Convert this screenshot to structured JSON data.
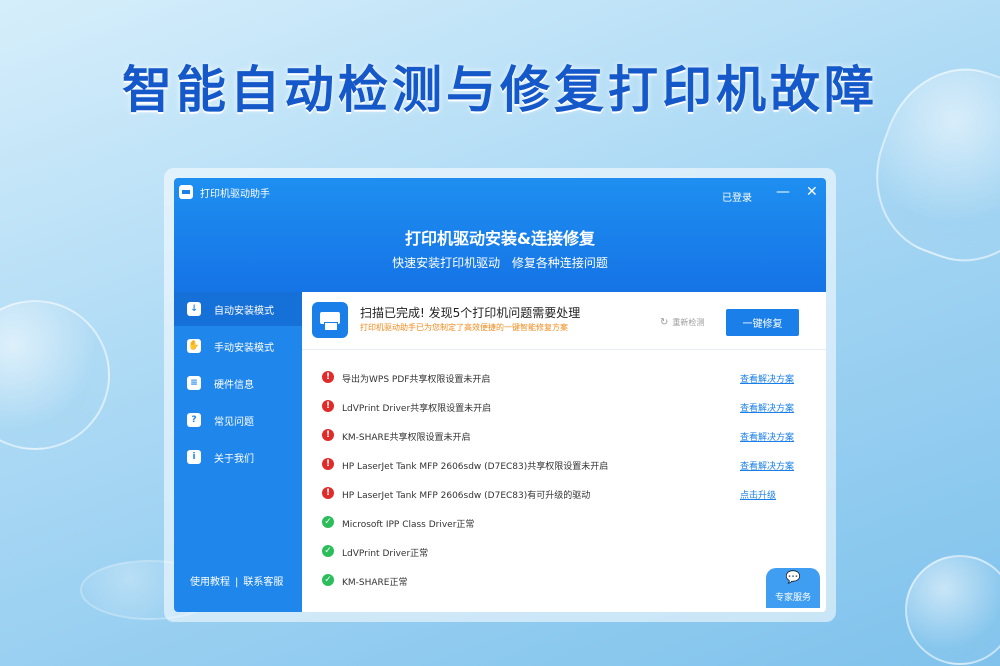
{
  "headline": "智能自动检测与修复打印机故障",
  "window": {
    "app_title": "打印机驱动助手",
    "login_label": "已登录",
    "minimize_glyph": "—",
    "close_glyph": "✕",
    "hero_title": "打印机驱动安装&连接修复",
    "hero_subtitle": "快速安装打印机驱动 修复各种连接问题"
  },
  "sidebar": {
    "items": [
      {
        "label": "自动安装模式",
        "icon": "download-icon",
        "glyph": "↓",
        "active": true
      },
      {
        "label": "手动安装模式",
        "icon": "hand-icon",
        "glyph": "✋",
        "active": false
      },
      {
        "label": "硬件信息",
        "icon": "list-icon",
        "glyph": "≡",
        "active": false
      },
      {
        "label": "常见问题",
        "icon": "question-icon",
        "glyph": "?",
        "active": false
      },
      {
        "label": "关于我们",
        "icon": "info-icon",
        "glyph": "i",
        "active": false
      }
    ],
    "footer_tutorial": "使用教程",
    "footer_separator": "|",
    "footer_contact": "联系客服"
  },
  "banner": {
    "title": "扫描已完成! 发现5个打印机问题需要处理",
    "subtitle": "打印机驱动助手已为您制定了高效便捷的一键智能修复方案",
    "recheck_label": "重新检测",
    "recheck_glyph": "↻",
    "fix_button": "一键修复"
  },
  "issues": [
    {
      "text": "导出为WPS PDF共享权限设置未开启",
      "status": "error",
      "glyph": "!",
      "link": "查看解决方案"
    },
    {
      "text": "LdVPrint Driver共享权限设置未开启",
      "status": "error",
      "glyph": "!",
      "link": "查看解决方案"
    },
    {
      "text": "KM-SHARE共享权限设置未开启",
      "status": "error",
      "glyph": "!",
      "link": "查看解决方案"
    },
    {
      "text": "HP LaserJet Tank MFP 2606sdw (D7EC83)共享权限设置未开启",
      "status": "error",
      "glyph": "!",
      "link": "查看解决方案"
    },
    {
      "text": "HP LaserJet Tank MFP 2606sdw (D7EC83)有可升级的驱动",
      "status": "error",
      "glyph": "!",
      "link": "点击升级"
    },
    {
      "text": "Microsoft IPP Class Driver正常",
      "status": "ok",
      "glyph": "✓",
      "link": ""
    },
    {
      "text": "LdVPrint Driver正常",
      "status": "ok",
      "glyph": "✓",
      "link": ""
    },
    {
      "text": "KM-SHARE正常",
      "status": "ok",
      "glyph": "✓",
      "link": ""
    }
  ],
  "expert": {
    "label": "专家服务",
    "glyph": "💬"
  },
  "colors": {
    "brand_blue": "#1a7fe8",
    "error_red": "#e02b2b",
    "ok_green": "#2bbd5a",
    "notice_orange": "#f08a1c"
  }
}
